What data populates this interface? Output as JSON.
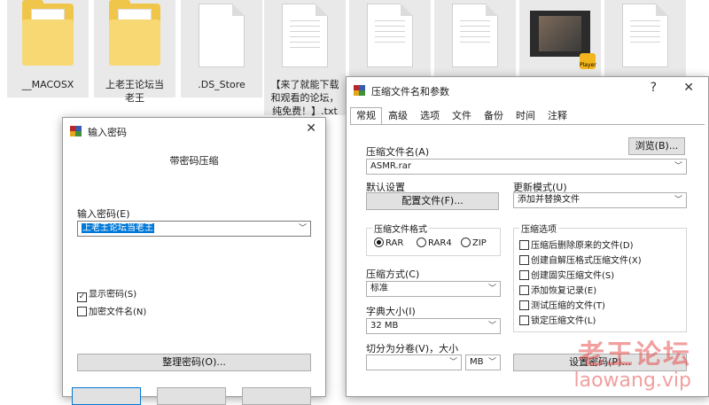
{
  "file_tiles": [
    {
      "name": "__MACOSX",
      "icon": "folder-icon"
    },
    {
      "name": "上老王论坛当老王",
      "icon": "folder-icon"
    },
    {
      "name": ".DS_Store",
      "icon": "document-icon"
    },
    {
      "name": "【来了就能下载和观看的论坛，纯免费！】.txt",
      "icon": "text-file-icon"
    },
    {
      "name": "",
      "icon": "document-icon"
    },
    {
      "name": "",
      "icon": "document-icon"
    },
    {
      "name": "",
      "icon": "video-file-icon"
    },
    {
      "name": "",
      "icon": "document-icon"
    }
  ],
  "video_badge": "Player",
  "archive_dialog": {
    "title": "压缩文件名和参数",
    "help": "?",
    "close": "✕",
    "tabs": [
      "常规",
      "高级",
      "选项",
      "文件",
      "备份",
      "时间",
      "注释"
    ],
    "archive_name_label": "压缩文件名(A)",
    "browse_button": "浏览(B)...",
    "archive_name_value": "ASMR.rar",
    "default_settings_label": "默认设置",
    "profiles_button": "配置文件(F)...",
    "update_mode_label": "更新模式(U)",
    "update_mode_value": "添加并替换文件",
    "format_group": "压缩文件格式",
    "formats": [
      "RAR",
      "RAR4",
      "ZIP"
    ],
    "selected_format": "RAR",
    "options_group": "压缩选项",
    "options": [
      "压缩后删除原来的文件(D)",
      "创建自解压格式压缩文件(X)",
      "创建固实压缩文件(S)",
      "添加恢复记录(E)",
      "测试压缩的文件(T)",
      "锁定压缩文件(L)"
    ],
    "method_label": "压缩方式(C)",
    "method_value": "标准",
    "dict_label": "字典大小(I)",
    "dict_value": "32 MB",
    "split_label": "切分为分卷(V)，大小",
    "split_unit": "MB",
    "set_password_button": "设置密码(P)..."
  },
  "password_dialog": {
    "title": "输入密码",
    "close": "✕",
    "subtitle": "带密码压缩",
    "enter_label": "输入密码(E)",
    "password_value": "上老王论坛当老王",
    "show_password_label": "显示密码(S)",
    "show_password_checked": true,
    "encrypt_names_label": "加密文件名(N)",
    "encrypt_names_checked": false,
    "organize_button": "整理密码(O)..."
  },
  "watermark": {
    "cn": "老王论坛",
    "en": "laowang.vip"
  },
  "colors": {
    "folder": "#f0c64a",
    "accent_blue": "#0078d7",
    "selection": "#0078d7",
    "watermark": "#e65050"
  }
}
